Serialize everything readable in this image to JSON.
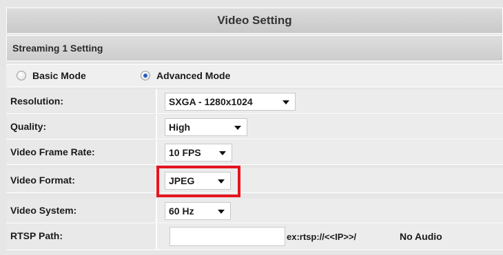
{
  "header": {
    "title": "Video Setting"
  },
  "section": {
    "title": "Streaming 1 Setting"
  },
  "mode": {
    "options": [
      {
        "label": "Basic Mode",
        "selected": false
      },
      {
        "label": "Advanced Mode",
        "selected": true
      }
    ]
  },
  "fields": [
    {
      "label": "Resolution:",
      "value": "SXGA - 1280x1024"
    },
    {
      "label": "Quality:",
      "value": "High"
    },
    {
      "label": "Video Frame Rate:",
      "value": "10 FPS"
    },
    {
      "label": "Video Format:",
      "value": "JPEG"
    },
    {
      "label": "Video System:",
      "value": "60 Hz"
    }
  ],
  "rtsp": {
    "label": "RTSP Path:",
    "value": "",
    "hint": "ex:rtsp://<<IP>>/",
    "audio": "No Audio"
  },
  "colors": {
    "highlight": "#e6141e",
    "header_bg": "#d0d0d0",
    "row_bg": "#e9e9e9"
  }
}
